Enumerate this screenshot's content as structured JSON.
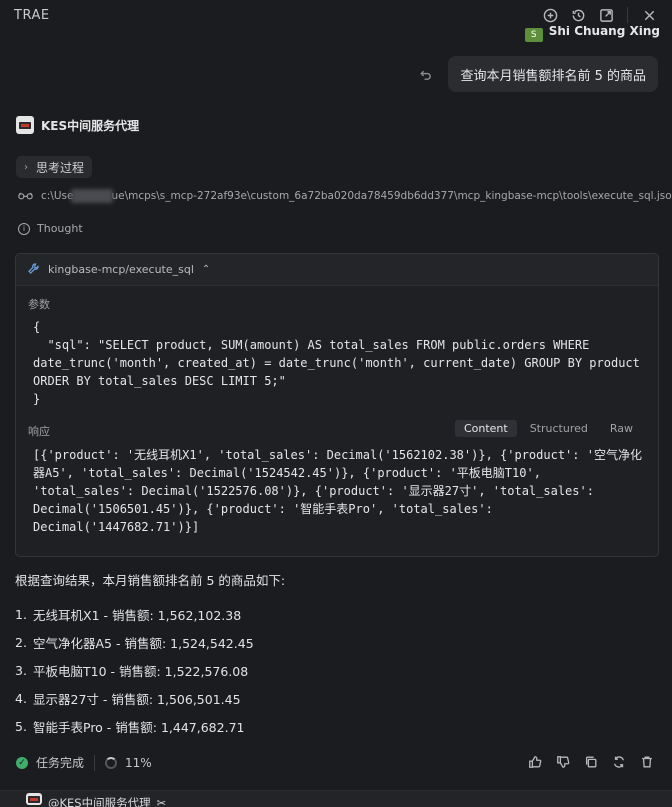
{
  "window": {
    "title": "TRAE",
    "icons": [
      "add-chat-icon",
      "history-icon",
      "popout-icon",
      "close-icon"
    ]
  },
  "user": {
    "name": "Shi Chuang Xing"
  },
  "query": {
    "text": "查询本月销售额排名前 5 的商品"
  },
  "agent": {
    "name": "KES中间服务代理"
  },
  "thinking": {
    "label": "思考过程"
  },
  "context_path": {
    "prefix": "c:\\Use",
    "suffix": "ue\\mcps\\s_mcp-272af93e\\custom_6a72ba020da78459db6dd377\\mcp_kingbase-mcp\\tools\\execute_sql.json"
  },
  "thought": {
    "label": "Thought"
  },
  "tool": {
    "name": "kingbase-mcp/execute_sql",
    "params_label": "参数",
    "params": "{\n  \"sql\": \"SELECT product, SUM(amount) AS total_sales FROM public.orders WHERE date_trunc('month', created_at) = date_trunc('month', current_date) GROUP BY product ORDER BY total_sales DESC LIMIT 5;\"\n}",
    "response_label": "响应",
    "tabs": [
      {
        "label": "Content",
        "active": true
      },
      {
        "label": "Structured",
        "active": false
      },
      {
        "label": "Raw",
        "active": false
      }
    ],
    "response": "[{'product': '无线耳机X1', 'total_sales': Decimal('1562102.38')}, {'product': '空气净化器A5', 'total_sales': Decimal('1524542.45')}, {'product': '平板电脑T10', 'total_sales': Decimal('1522576.08')}, {'product': '显示器27寸', 'total_sales': Decimal('1506501.45')}, {'product': '智能手表Pro', 'total_sales': Decimal('1447682.71')}]"
  },
  "summary": "根据查询结果，本月销售额排名前 5 的商品如下:",
  "results": [
    {
      "num": "1.",
      "text": "无线耳机X1 - 销售额: 1,562,102.38"
    },
    {
      "num": "2.",
      "text": "空气净化器A5 - 销售额: 1,524,542.45"
    },
    {
      "num": "3.",
      "text": "平板电脑T10 - 销售额: 1,522,576.08"
    },
    {
      "num": "4.",
      "text": "显示器27寸 - 销售额: 1,506,501.45"
    },
    {
      "num": "5.",
      "text": "智能手表Pro - 销售额: 1,447,682.71"
    }
  ],
  "status": {
    "label": "任务完成",
    "progress": "11%"
  },
  "actions": [
    "thumbs-up-icon",
    "thumbs-down-icon",
    "copy-icon",
    "regenerate-icon",
    "delete-icon"
  ],
  "bottom": {
    "mention": "@KES中间服务代理",
    "tool_icon": "tools-icon"
  },
  "colors": {
    "background": "#1b1c1f",
    "success": "#3fae6a",
    "link": "#6a9bd6"
  }
}
